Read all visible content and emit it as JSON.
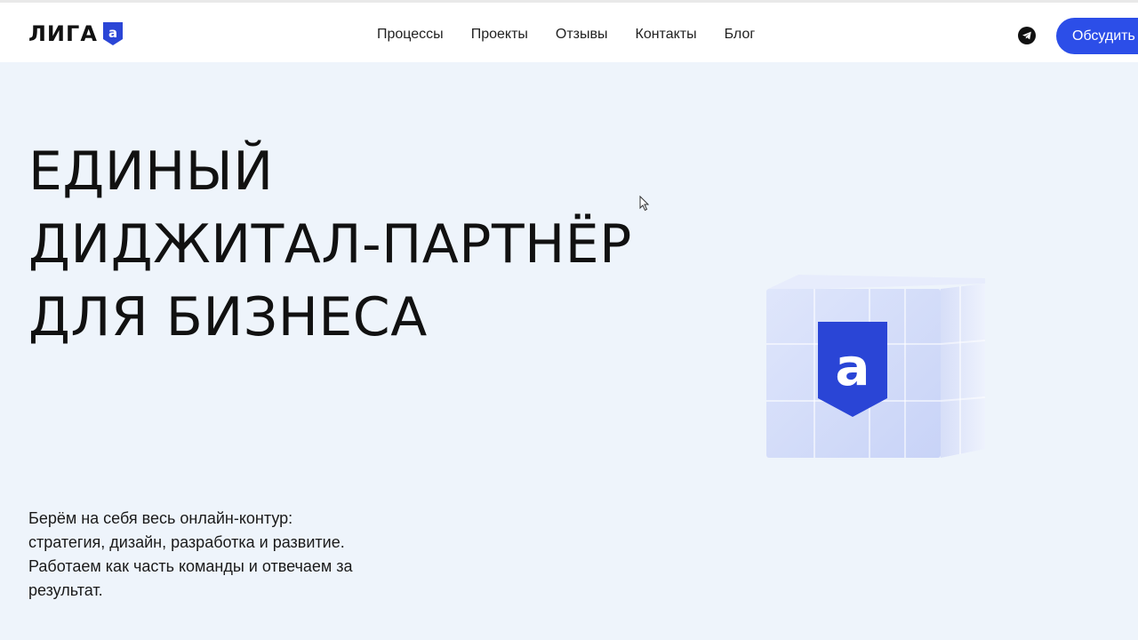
{
  "header": {
    "logo_text": "ЛИГА",
    "logo_badge_letter": "a",
    "nav": [
      {
        "label": "Процессы"
      },
      {
        "label": "Проекты"
      },
      {
        "label": "Отзывы"
      },
      {
        "label": "Контакты"
      },
      {
        "label": "Блог"
      }
    ],
    "telegram_icon": "telegram-icon",
    "cta_label": "Обсудить"
  },
  "hero": {
    "title_lines": [
      "ЕДИНЫЙ",
      "ДИДЖИТАЛ-ПАРТНЁР",
      "ДЛЯ БИЗНЕСА"
    ],
    "description_lines": [
      "Берём на себя весь онлайн-контур:",
      "стратегия, дизайн, разработка и развитие.",
      "Работаем как часть команды и отвечаем за",
      "результат."
    ],
    "cube_letter": "a"
  },
  "colors": {
    "accent": "#2c4ee8",
    "background": "#eef4fb",
    "header_bg": "#ffffff",
    "text": "#111111",
    "badge": "#2a45d6"
  }
}
